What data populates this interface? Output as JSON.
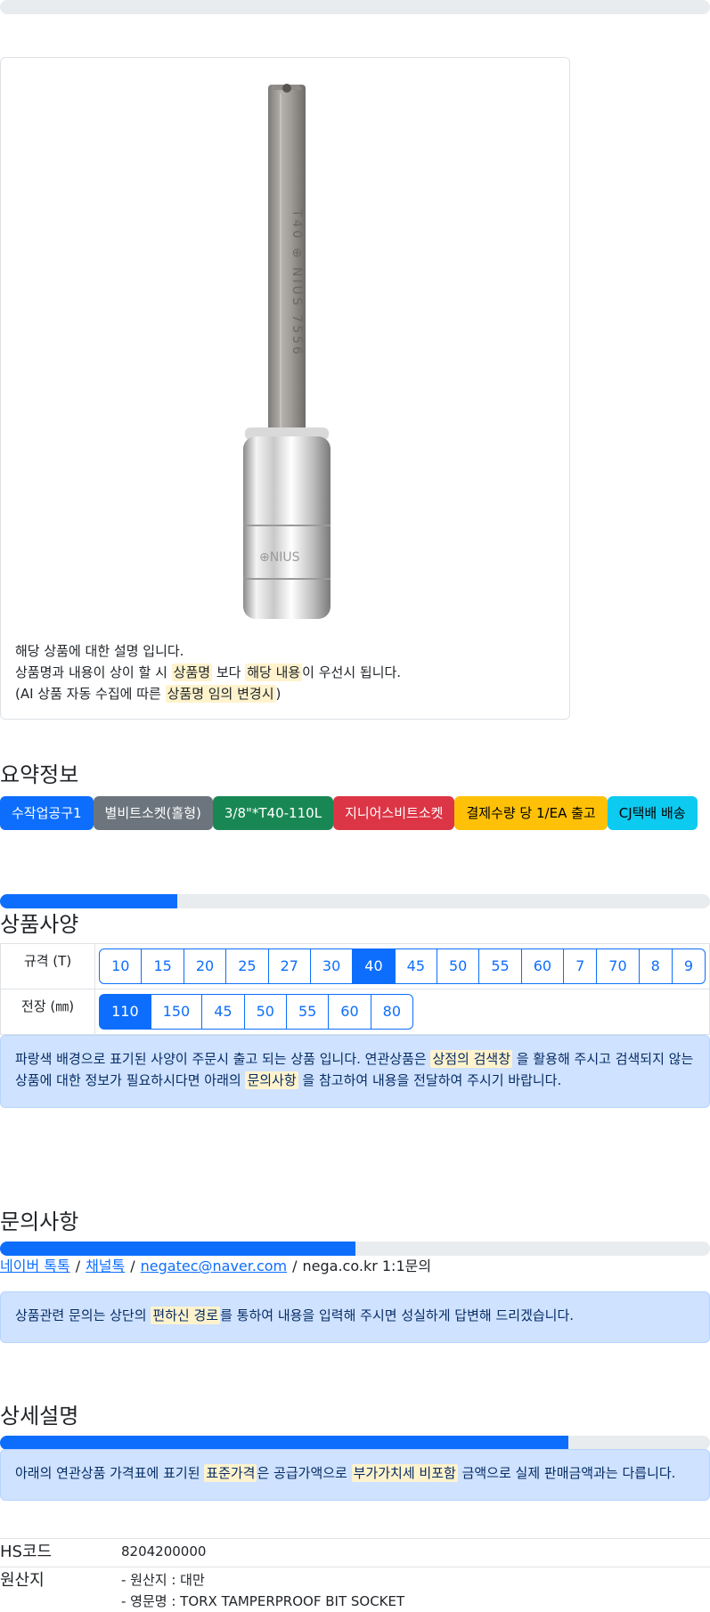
{
  "product": {
    "image_alt": "TORX tamperproof bit socket",
    "desc_line1": "해당 상품에 대한 설명 입니다.",
    "desc_line2_a": "상품명과 내용이 상이 할 시 ",
    "desc_line2_hl1": "상품명",
    "desc_line2_b": " 보다 ",
    "desc_line2_hl2": "해당 내용",
    "desc_line2_c": "이 우선시 됩니다.",
    "desc_line3_a": "(AI 상품 자동 수집에 따른 ",
    "desc_line3_hl": "상품명 임의 변경시",
    "desc_line3_b": ")"
  },
  "summary": {
    "title": "요약정보",
    "badges": [
      {
        "label": "수작업공구1",
        "color": "#0d6efd"
      },
      {
        "label": "별비트소켓(홀형)",
        "color": "#6c757d"
      },
      {
        "label": "3/8\"*T40-110L",
        "color": "#198754"
      },
      {
        "label": "지니어스비트소켓",
        "color": "#dc3545"
      },
      {
        "label": "결제수량 당 1/EA 출고",
        "color": "#ffc107"
      },
      {
        "label": "CJ택배 배송",
        "color": "#0dcaf0"
      }
    ],
    "progress": 0.25
  },
  "specs": {
    "title": "상품사양",
    "rows": [
      {
        "label": "규격 (T)",
        "options": [
          "10",
          "15",
          "20",
          "25",
          "27",
          "30",
          "40",
          "45",
          "50",
          "55",
          "60",
          "7",
          "70",
          "8",
          "9"
        ],
        "selected": "40"
      },
      {
        "label": "전장 (㎜)",
        "options": [
          "110",
          "150",
          "45",
          "50",
          "55",
          "60",
          "80"
        ],
        "selected": "110"
      }
    ],
    "notice_a": "파랑색 배경으로 표기된 사양이 주문시 출고 되는 상품 입니다. 연관상품은 ",
    "notice_hl1": "상점의 검색창",
    "notice_b": " 을 활용해 주시고 검색되지 않는 상품에 대한 정보가 필요하시다면 아래의 ",
    "notice_hl2": "문의사항",
    "notice_c": " 을 참고하여 내용을 전달하여 주시기 바랍니다."
  },
  "inquiry": {
    "title": "문의사항",
    "progress": 0.5,
    "links": [
      "네이버 톡톡",
      "채널톡",
      "negatec@naver.com"
    ],
    "plain": "nega.co.kr 1:1문의",
    "separator": "/",
    "notice_a": "상품관련 문의는 상단의 ",
    "notice_hl": "편하신 경로",
    "notice_b": "를 통하여 내용을 입력해 주시면 성실하게 답변해 드리겠습니다."
  },
  "detail": {
    "title": "상세설명",
    "progress": 0.8,
    "notice_a": "아래의 연관상품 가격표에 표기된 ",
    "notice_hl1": "표준가격",
    "notice_b": "은 공급가액으로 ",
    "notice_hl2": "부가가치세 비포함",
    "notice_c": " 금액으로 실제 판매금액과는 다릅니다."
  },
  "info": {
    "hs_key": "HS코드",
    "hs_val": "8204200000",
    "origin_key": "원산지",
    "origin_line1": "- 원산지 : 대만",
    "origin_line2": "- 영문명 : TORX TAMPERPROOF BIT SOCKET"
  }
}
